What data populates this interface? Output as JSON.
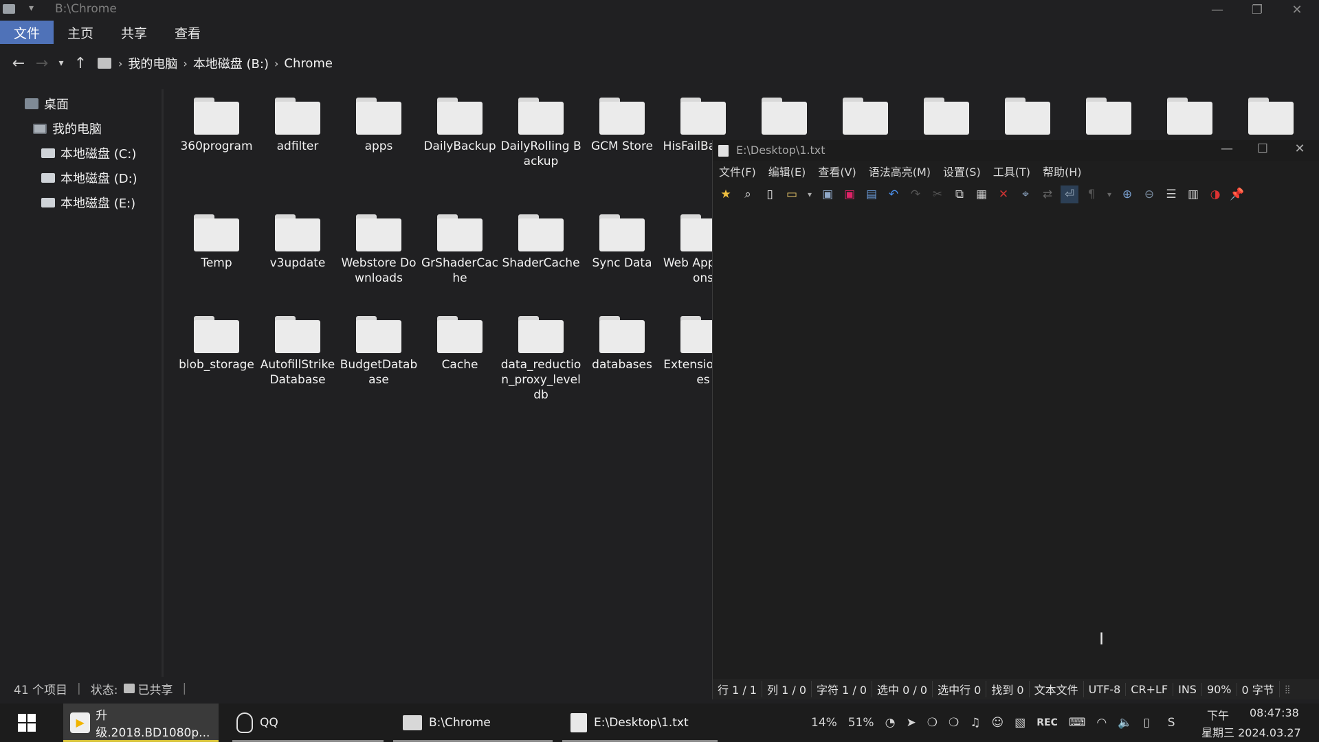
{
  "explorer": {
    "title": "B:\\Chrome",
    "ribbon_tabs": [
      "文件",
      "主页",
      "共享",
      "查看"
    ],
    "breadcrumb": [
      "我的电脑",
      "本地磁盘 (B:)",
      "Chrome"
    ],
    "sidebar": [
      {
        "label": "桌面",
        "icon": "desktop-icon"
      },
      {
        "label": "我的电脑",
        "icon": "computer-icon"
      },
      {
        "label": "本地磁盘 (C:)",
        "icon": "drive-icon"
      },
      {
        "label": "本地磁盘 (D:)",
        "icon": "drive-icon"
      },
      {
        "label": "本地磁盘 (E:)",
        "icon": "drive-icon"
      }
    ],
    "folders": [
      "360program",
      "adfilter",
      "apps",
      "DailyBackup",
      "DailyRolling Backup",
      "GCM Store",
      "HisFailBackup",
      "Temp",
      "v3update",
      "Webstore Downloads",
      "GrShaderCache",
      "ShaderCache",
      "Sync Data",
      "Web Applications",
      "blob_storage",
      "AutofillStrikeDatabase",
      "BudgetDatabase",
      "Cache",
      "data_reduction_proxy_leveldb",
      "databases",
      "Extension Rules"
    ],
    "top_row_extra_count": 7,
    "status": {
      "count": "41 个项目",
      "state_label": "状态:",
      "state_value": "已共享"
    }
  },
  "notepad": {
    "title": "E:\\Desktop\\1.txt",
    "menu": [
      "文件(F)",
      "编辑(E)",
      "查看(V)",
      "语法高亮(M)",
      "设置(S)",
      "工具(T)",
      "帮助(H)"
    ],
    "status": [
      "行 1 / 1",
      "列 1 / 0",
      "字符 1 / 0",
      "选中 0 / 0",
      "选中行 0",
      "找到 0",
      "文本文件",
      "UTF-8",
      "CR+LF",
      "INS",
      "90%",
      "0 字节"
    ]
  },
  "taskbar": {
    "items": [
      {
        "label": "升级.2018.BD1080p...",
        "icon": "video-player-icon"
      },
      {
        "label": "QQ",
        "icon": "qq-icon"
      },
      {
        "label": "B:\\Chrome",
        "icon": "folder-icon"
      },
      {
        "label": "E:\\Desktop\\1.txt",
        "icon": "notepad-icon"
      }
    ],
    "tray": {
      "cpu": "14%",
      "mem": "51%",
      "rec": "REC",
      "ampm": "下午",
      "time": "08:47:38",
      "date": "星期三 2024.03.27"
    }
  }
}
